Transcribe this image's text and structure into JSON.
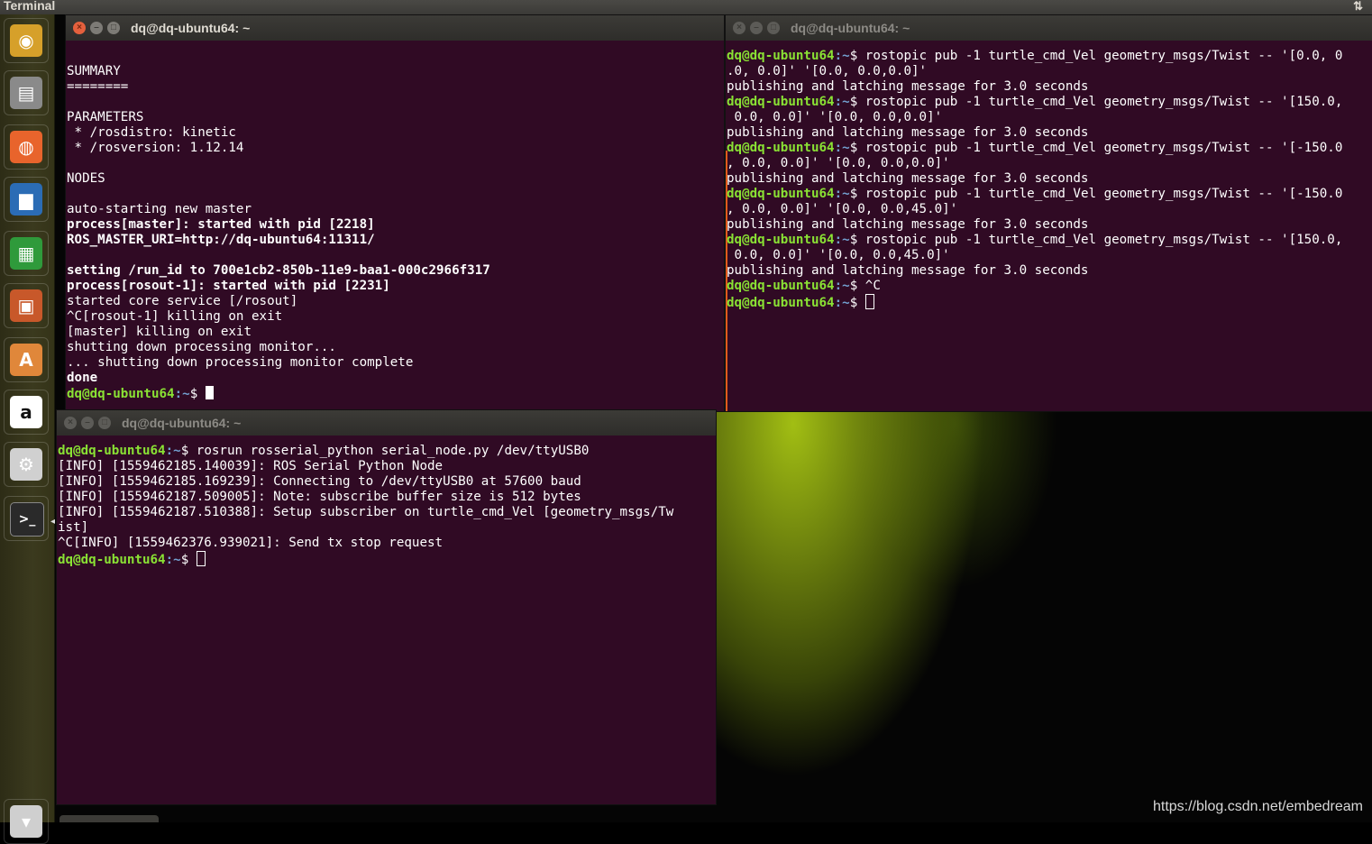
{
  "top_panel": {
    "title": "Terminal",
    "network_icon": "network-updown-icon"
  },
  "launcher": {
    "items": [
      {
        "name": "ubuntu-dash-icon",
        "glyph": "◉"
      },
      {
        "name": "files-icon",
        "glyph": "▤"
      },
      {
        "name": "firefox-icon",
        "glyph": "◍"
      },
      {
        "name": "libreoffice-writer-icon",
        "glyph": "▆"
      },
      {
        "name": "libreoffice-calc-icon",
        "glyph": "▦"
      },
      {
        "name": "libreoffice-impress-icon",
        "glyph": "▣"
      },
      {
        "name": "software-center-icon",
        "glyph": "A"
      },
      {
        "name": "amazon-icon",
        "glyph": "a"
      },
      {
        "name": "system-settings-icon",
        "glyph": "⚙"
      },
      {
        "name": "terminal-icon",
        "glyph": ">_"
      },
      {
        "name": "trash-icon",
        "glyph": "▾"
      }
    ]
  },
  "windows": {
    "roscore": {
      "title": "dq@dq-ubuntu64: ~",
      "lines": [
        "",
        "SUMMARY",
        "========",
        "",
        "PARAMETERS",
        " * /rosdistro: kinetic",
        " * /rosversion: 1.12.14",
        "",
        "NODES",
        "",
        "auto-starting new master",
        "process[master]: started with pid [2218]",
        "ROS_MASTER_URI=http://dq-ubuntu64:11311/",
        "",
        "setting /run_id to 700e1cb2-850b-11e9-baa1-000c2966f317",
        "process[rosout-1]: started with pid [2231]",
        "started core service [/rosout]",
        "^C[rosout-1] killing on exit",
        "[master] killing on exit",
        "shutting down processing monitor...",
        "... shutting down processing monitor complete",
        "done"
      ],
      "prompt_user": "dq@dq-ubuntu64",
      "prompt_path": ":~",
      "prompt_symbol": "$ "
    },
    "rostopic": {
      "title": "dq@dq-ubuntu64: ~",
      "prompt_user": "dq@dq-ubuntu64",
      "prompt_path": ":~",
      "prompt_symbol": "$ ",
      "lines": [
        {
          "cmd": "rostopic pub -1 turtle_cmd_Vel geometry_msgs/Twist -- '[0.0, 0"
        },
        {
          "text": ".0, 0.0]' '[0.0, 0.0,0.0]'"
        },
        {
          "text": "publishing and latching message for 3.0 seconds"
        },
        {
          "cmd": "rostopic pub -1 turtle_cmd_Vel geometry_msgs/Twist -- '[150.0,"
        },
        {
          "text": " 0.0, 0.0]' '[0.0, 0.0,0.0]'"
        },
        {
          "text": "publishing and latching message for 3.0 seconds"
        },
        {
          "cmd": "rostopic pub -1 turtle_cmd_Vel geometry_msgs/Twist -- '[-150.0"
        },
        {
          "text": ", 0.0, 0.0]' '[0.0, 0.0,0.0]'"
        },
        {
          "text": "publishing and latching message for 3.0 seconds"
        },
        {
          "cmd": "rostopic pub -1 turtle_cmd_Vel geometry_msgs/Twist -- '[-150.0"
        },
        {
          "text": ", 0.0, 0.0]' '[0.0, 0.0,45.0]'"
        },
        {
          "text": "publishing and latching message for 3.0 seconds"
        },
        {
          "cmd": "rostopic pub -1 turtle_cmd_Vel geometry_msgs/Twist -- '[150.0,"
        },
        {
          "text": " 0.0, 0.0]' '[0.0, 0.0,45.0]'"
        },
        {
          "text": "publishing and latching message for 3.0 seconds"
        },
        {
          "cmd": "^C"
        }
      ]
    },
    "rosserial": {
      "title": "dq@dq-ubuntu64: ~",
      "prompt_user": "dq@dq-ubuntu64",
      "prompt_path": ":~",
      "prompt_symbol": "$ ",
      "command": "rosrun rosserial_python serial_node.py /dev/ttyUSB0",
      "lines": [
        "[INFO] [1559462185.140039]: ROS Serial Python Node",
        "[INFO] [1559462185.169239]: Connecting to /dev/ttyUSB0 at 57600 baud",
        "[INFO] [1559462187.509005]: Note: subscribe buffer size is 512 bytes",
        "[INFO] [1559462187.510388]: Setup subscriber on turtle_cmd_Vel [geometry_msgs/Tw",
        "ist]",
        "^C[INFO] [1559462376.939021]: Send tx stop request"
      ]
    }
  },
  "bold_lines_roscore": [
    11,
    12,
    14,
    15,
    21
  ],
  "watermark": "https://blog.csdn.net/embedream"
}
